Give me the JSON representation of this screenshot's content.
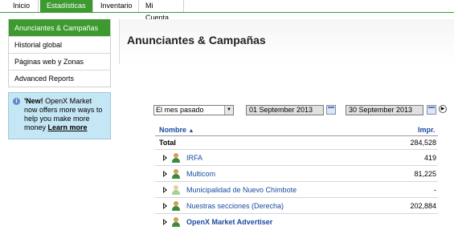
{
  "tabs": [
    {
      "label": "Inicio"
    },
    {
      "label": "Estadísticas",
      "active": true
    },
    {
      "label": "Inventario"
    },
    {
      "label": "Mi Cuenta"
    }
  ],
  "sidebar": {
    "items": [
      {
        "label": "Anunciantes & Campañas",
        "active": true
      },
      {
        "label": "Historial global"
      },
      {
        "label": "Páginas web y Zonas"
      },
      {
        "label": "Advanced Reports"
      }
    ]
  },
  "promo": {
    "text_bold": "'New!",
    "text": " OpenX Market now offers more ways to help you make more money ",
    "link": "Learn more"
  },
  "page": {
    "title": "Anunciantes & Campañas"
  },
  "filters": {
    "period": "El mes pasado",
    "start_date": "01 September 2013",
    "end_date": "30 September 2013"
  },
  "table": {
    "col_name": "Nombre",
    "sort_indicator": "▲",
    "col_impr": "Impr.",
    "total_label": "Total",
    "total_value": "284,528",
    "rows": [
      {
        "name": "IRFA",
        "value": "419"
      },
      {
        "name": "Multicom",
        "value": "81,225"
      },
      {
        "name": "Municipalidad de Nuevo Chimbote",
        "value": "-"
      },
      {
        "name": "Nuestras secciones (Derecha)",
        "value": "202,884"
      },
      {
        "name": "OpenX Market Advertiser",
        "value": ""
      }
    ]
  },
  "colors": {
    "accent_green": "#3c9a2e",
    "link_blue": "#1a4aa0",
    "promo_bg": "#c5e6f5"
  },
  "icons": [
    "expand-arrow-icon",
    "advertiser-icon",
    "calendar-icon",
    "go-icon",
    "info-icon",
    "select-arrow-icon"
  ]
}
